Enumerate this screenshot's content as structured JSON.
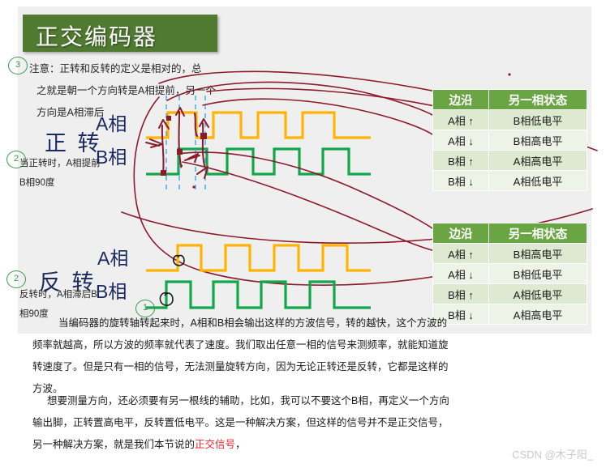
{
  "slide": {
    "title": "正交编码器",
    "title_bg": "#4f7a30",
    "notes": {
      "line1": "注意：正转和反转的定义是相对的，总",
      "line2": "之就是朝一个方向转是A相提前，另一个",
      "line3": "方向是A相滞后"
    },
    "forward": {
      "heading": "正 转",
      "phase_a": "A相",
      "phase_b": "B相",
      "desc_line1": "当正转时，A相提前",
      "desc_line2": "B相90度",
      "marker": "2"
    },
    "reverse": {
      "heading": "反 转",
      "phase_a": "A相",
      "phase_b": "B相",
      "desc_line1": "反转时，A相滞后B",
      "desc_line2": "相90度",
      "marker": "2"
    },
    "markers": {
      "top": "3",
      "bottom": "1"
    },
    "colors": {
      "phase_a_wave": "#ffb500",
      "phase_b_wave": "#13a64a",
      "annotation_red": "#8c1a2b",
      "annotation_cyan": "#2aa6dd",
      "table_header": "#6aa544",
      "accent_red_text": "#e8232a"
    }
  },
  "table_forward": {
    "headers": [
      "边沿",
      "另一相状态"
    ],
    "rows": [
      [
        "A相 ↑",
        "B相低电平"
      ],
      [
        "A相 ↓",
        "B相高电平"
      ],
      [
        "B相 ↑",
        "A相高电平"
      ],
      [
        "B相 ↓",
        "A相低电平"
      ]
    ]
  },
  "table_reverse": {
    "headers": [
      "边沿",
      "另一相状态"
    ],
    "rows": [
      [
        "A相 ↑",
        "B相高电平"
      ],
      [
        "A相 ↓",
        "B相低电平"
      ],
      [
        "B相 ↑",
        "A相低电平"
      ],
      [
        "B相 ↓",
        "A相高电平"
      ]
    ]
  },
  "body": {
    "p1_l1": "当编码器的旋转轴转起来时，A相和B相会输出这样的方波信号，转的越快，这个方波的",
    "p1_l2": "频率就越高，所以方波的频率就代表了速度。我们取出任意一相的信号来测频率，就能知道旋",
    "p1_l3": "转速度了。但是只有一相的信号，无法测量旋转方向，因为无论正转还是反转，它都是这样的",
    "p1_l4": "方波。",
    "p2_l1": "想要测量方向，还必须要有另一根线的辅助，比如，我可以不要这个B相，再定义一个方向",
    "p2_l2": "输出脚，正转置高电平，反转置低电平。这是一种解决方案，但这样的信号并不是正交信号，",
    "p2_l3_a": "另一种解决方案，就是我们本节说的",
    "p2_l3_red": "正交信号",
    "p2_l3_b": "，"
  },
  "watermark": "CSDN @木子阳_"
}
